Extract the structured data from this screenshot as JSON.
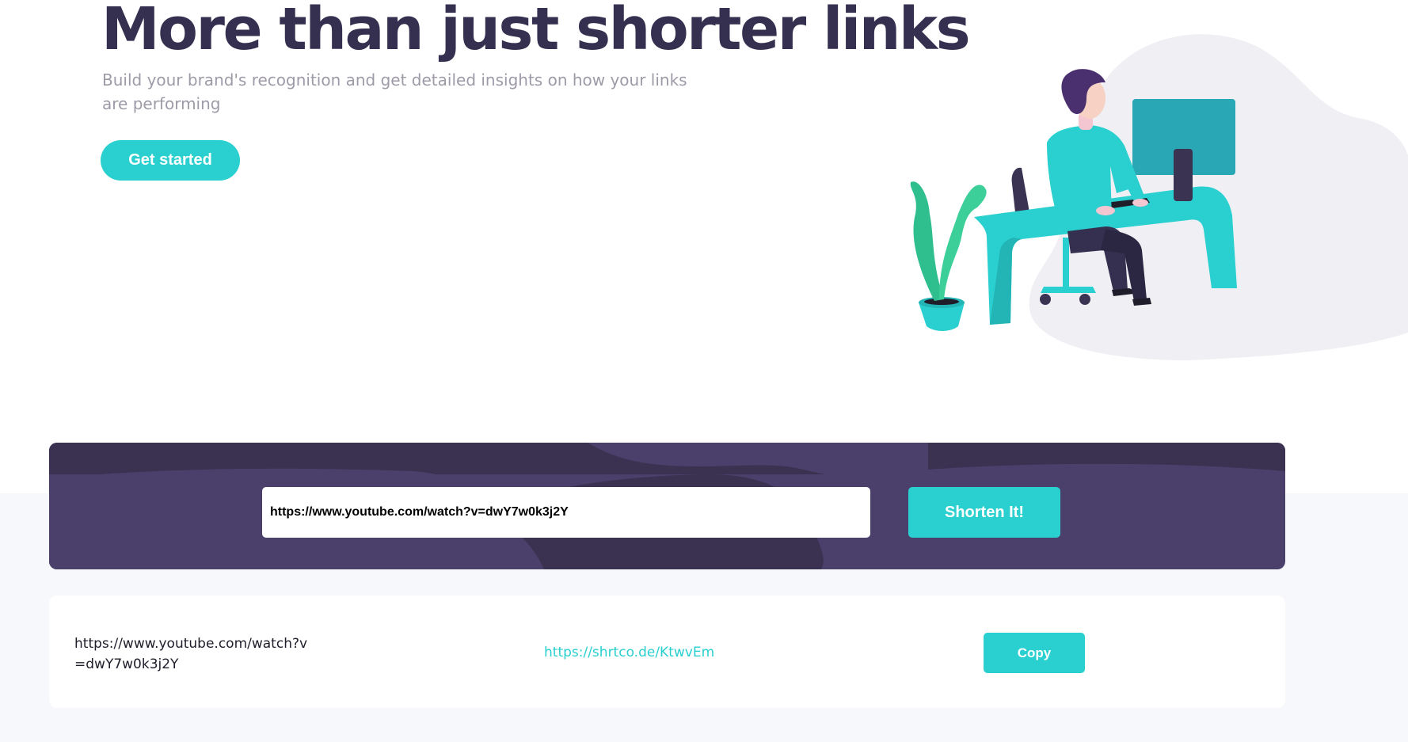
{
  "hero": {
    "title": "More than just shorter links",
    "subtitle": "Build your brand's recognition and get detailed insights on how your links are performing",
    "cta_label": "Get started"
  },
  "illustration": {
    "icon": "person-working-at-desk-illustration"
  },
  "shorten": {
    "input_value": "https://www.youtube.com/watch?v=dwY7w0k3j2Y",
    "button_label": "Shorten It!"
  },
  "results": [
    {
      "original_url": "https://www.youtube.com/watch?v=dwY7w0k3j2Y",
      "short_url": "https://shrtco.de/KtwvEm",
      "copy_label": "Copy"
    }
  ],
  "colors": {
    "brand_dark": "#35304f",
    "accent_cyan": "#2acfcf",
    "panel_violet": "#4b3f6b",
    "gray_text": "#9e9aa7"
  }
}
